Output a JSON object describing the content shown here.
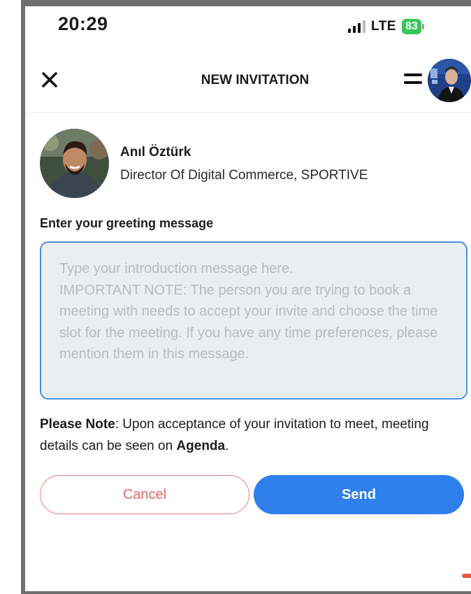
{
  "status_bar": {
    "time": "20:29",
    "network": "LTE",
    "battery": "83"
  },
  "header": {
    "title": "NEW INVITATION",
    "close_icon": "close-icon",
    "menu_icon": "hamburger-menu-icon"
  },
  "profile": {
    "name": "Anıl Öztürk",
    "role": "Director Of Digital Commerce, SPORTIVE"
  },
  "form": {
    "label": "Enter your greeting message",
    "value": "",
    "placeholder": "Type your introduction message here.\nIMPORTANT NOTE: The person you are trying to book a meeting with needs to accept your invite and choose the time slot for the meeting. If you have any time preferences, please mention them in this message."
  },
  "note": {
    "prefix": "Please Note",
    "text": ": Upon acceptance of your invitation to meet, meeting details can be seen on ",
    "link": "Agenda",
    "suffix": "."
  },
  "buttons": {
    "cancel": "Cancel",
    "send": "Send"
  },
  "colors": {
    "primary": "#2f80ed",
    "cancel": "#e06b6b",
    "input_border": "#4a90e2",
    "input_bg": "#e9eef1",
    "battery": "#35c759"
  }
}
